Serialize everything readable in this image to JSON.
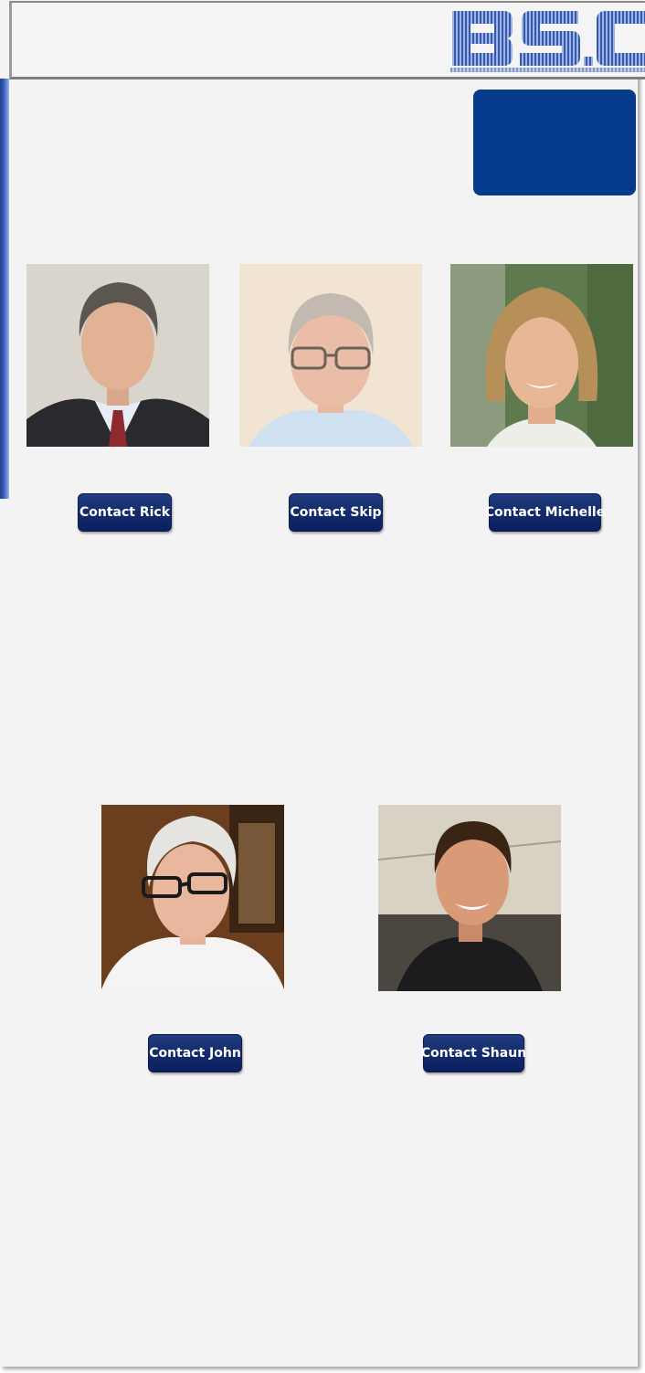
{
  "header": {
    "logo_text": "BSC",
    "logo_color": "#3459b0"
  },
  "accent_color": "#063a8a",
  "team": [
    {
      "name": "Rick",
      "contact_label": "Contact Rick"
    },
    {
      "name": "Skip",
      "contact_label": "Contact Skip"
    },
    {
      "name": "Michelle",
      "contact_label": "Contact Michelle"
    },
    {
      "name": "John",
      "contact_label": "Contact John"
    },
    {
      "name": "Shaun",
      "contact_label": "Contact Shaun"
    }
  ]
}
